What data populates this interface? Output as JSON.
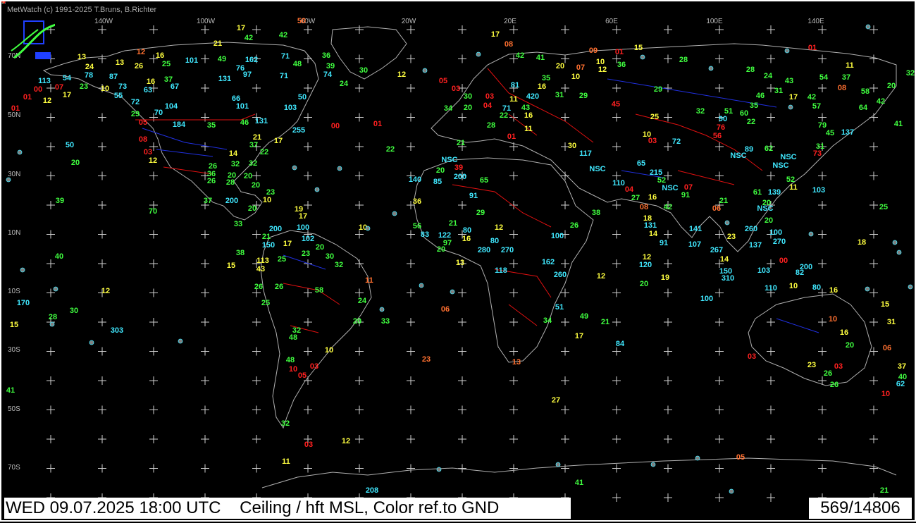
{
  "header": {
    "credit": "MetWatch  (c) 1991-2025 T.Bruns, B.Richter"
  },
  "footer": {
    "timestamp": "WED 09.07.2025 18:00 UTC",
    "parameter": "Ceiling / hft MSL, Color ref.to GND",
    "station_count": "569/14806"
  },
  "colors": {
    "background": "#000000",
    "coastline": "#b0b0b0",
    "country_border": "#e01010",
    "state_border": "#2030e0",
    "grid": "#d0d0d0",
    "red": "#ff2020",
    "orange": "#ff7030",
    "yellow": "#ffff40",
    "green": "#40ff40",
    "cyan": "#40e8ff"
  },
  "longitude_labels": [
    "140W",
    "100W",
    "60W",
    "20W",
    "20E",
    "60E",
    "100E",
    "140E"
  ],
  "latitude_labels": [
    "70N",
    "50N",
    "30N",
    "10N",
    "10S",
    "30S",
    "50S",
    "70S"
  ],
  "stations": [
    {
      "t": "17",
      "c": "yellow"
    },
    {
      "t": "42",
      "c": "green"
    },
    {
      "t": "42",
      "c": "green"
    },
    {
      "t": "50",
      "c": "orange"
    },
    {
      "t": "21",
      "c": "yellow"
    },
    {
      "t": "13",
      "c": "yellow"
    },
    {
      "t": "24",
      "c": "yellow"
    },
    {
      "t": "12",
      "c": "orange"
    },
    {
      "t": "16",
      "c": "yellow"
    },
    {
      "t": "13",
      "c": "yellow"
    },
    {
      "t": "26",
      "c": "yellow"
    },
    {
      "t": "25",
      "c": "green"
    },
    {
      "t": "101",
      "c": "cyan"
    },
    {
      "t": "49",
      "c": "green"
    },
    {
      "t": "162",
      "c": "cyan"
    },
    {
      "t": "71",
      "c": "cyan"
    },
    {
      "t": "48",
      "c": "green"
    },
    {
      "t": "36",
      "c": "green"
    },
    {
      "t": "39",
      "c": "green"
    },
    {
      "t": "30",
      "c": "green"
    },
    {
      "t": "74",
      "c": "cyan"
    },
    {
      "t": "24",
      "c": "green"
    },
    {
      "t": "113",
      "c": "cyan"
    },
    {
      "t": "54",
      "c": "cyan"
    },
    {
      "t": "78",
      "c": "cyan"
    },
    {
      "t": "87",
      "c": "cyan"
    },
    {
      "t": "16",
      "c": "yellow"
    },
    {
      "t": "37",
      "c": "green"
    },
    {
      "t": "131",
      "c": "cyan"
    },
    {
      "t": "76",
      "c": "cyan"
    },
    {
      "t": "97",
      "c": "cyan"
    },
    {
      "t": "71",
      "c": "cyan"
    },
    {
      "t": "00",
      "c": "red"
    },
    {
      "t": "07",
      "c": "red"
    },
    {
      "t": "23",
      "c": "green"
    },
    {
      "t": "10",
      "c": "yellow"
    },
    {
      "t": "73",
      "c": "cyan"
    },
    {
      "t": "63",
      "c": "cyan"
    },
    {
      "t": "67",
      "c": "cyan"
    },
    {
      "t": "01",
      "c": "red"
    },
    {
      "t": "12",
      "c": "yellow"
    },
    {
      "t": "17",
      "c": "yellow"
    },
    {
      "t": "55",
      "c": "cyan"
    },
    {
      "t": "72",
      "c": "cyan"
    },
    {
      "t": "66",
      "c": "cyan"
    },
    {
      "t": "101",
      "c": "cyan"
    },
    {
      "t": "50",
      "c": "cyan"
    },
    {
      "t": "103",
      "c": "cyan"
    },
    {
      "t": "01",
      "c": "red"
    },
    {
      "t": "29",
      "c": "green"
    },
    {
      "t": "70",
      "c": "cyan"
    },
    {
      "t": "104",
      "c": "cyan"
    },
    {
      "t": "46",
      "c": "green"
    },
    {
      "t": "131",
      "c": "cyan"
    },
    {
      "t": "05",
      "c": "red"
    },
    {
      "t": "184",
      "c": "cyan"
    },
    {
      "t": "35",
      "c": "green"
    },
    {
      "t": "255",
      "c": "cyan"
    },
    {
      "t": "00",
      "c": "red"
    },
    {
      "t": "01",
      "c": "red"
    },
    {
      "t": "08",
      "c": "red"
    },
    {
      "t": "21",
      "c": "yellow"
    },
    {
      "t": "37",
      "c": "green"
    },
    {
      "t": "17",
      "c": "yellow"
    },
    {
      "t": "50",
      "c": "cyan"
    },
    {
      "t": "03",
      "c": "red"
    },
    {
      "t": "14",
      "c": "yellow"
    },
    {
      "t": "22",
      "c": "green"
    },
    {
      "t": "22",
      "c": "green"
    },
    {
      "t": "20",
      "c": "green"
    },
    {
      "t": "12",
      "c": "yellow"
    },
    {
      "t": "26",
      "c": "green"
    },
    {
      "t": "32",
      "c": "green"
    },
    {
      "t": "32",
      "c": "green"
    },
    {
      "t": "36",
      "c": "green"
    },
    {
      "t": "20",
      "c": "green"
    },
    {
      "t": "20",
      "c": "green"
    },
    {
      "t": "26",
      "c": "green"
    },
    {
      "t": "28",
      "c": "green"
    },
    {
      "t": "20",
      "c": "green"
    },
    {
      "t": "23",
      "c": "green"
    },
    {
      "t": "39",
      "c": "green"
    },
    {
      "t": "37",
      "c": "green"
    },
    {
      "t": "200",
      "c": "cyan"
    },
    {
      "t": "10",
      "c": "yellow"
    },
    {
      "t": "20",
      "c": "green"
    },
    {
      "t": "19",
      "c": "yellow"
    },
    {
      "t": "70",
      "c": "green"
    },
    {
      "t": "17",
      "c": "yellow"
    },
    {
      "t": "33",
      "c": "green"
    },
    {
      "t": "200",
      "c": "cyan"
    },
    {
      "t": "100",
      "c": "cyan"
    },
    {
      "t": "10",
      "c": "yellow"
    },
    {
      "t": "21",
      "c": "green"
    },
    {
      "t": "102",
      "c": "cyan"
    },
    {
      "t": "150",
      "c": "cyan"
    },
    {
      "t": "17",
      "c": "yellow"
    },
    {
      "t": "20",
      "c": "green"
    },
    {
      "t": "40",
      "c": "green"
    },
    {
      "t": "38",
      "c": "green"
    },
    {
      "t": "23",
      "c": "green"
    },
    {
      "t": "113",
      "c": "yellow"
    },
    {
      "t": "25",
      "c": "green"
    },
    {
      "t": "30",
      "c": "green"
    },
    {
      "t": "15",
      "c": "yellow"
    },
    {
      "t": "43",
      "c": "yellow"
    },
    {
      "t": "32",
      "c": "green"
    },
    {
      "t": "11",
      "c": "orange"
    },
    {
      "t": "26",
      "c": "green"
    },
    {
      "t": "26",
      "c": "green"
    },
    {
      "t": "58",
      "c": "green"
    },
    {
      "t": "12",
      "c": "yellow"
    },
    {
      "t": "170",
      "c": "cyan"
    },
    {
      "t": "25",
      "c": "green"
    },
    {
      "t": "24",
      "c": "green"
    },
    {
      "t": "28",
      "c": "green"
    },
    {
      "t": "30",
      "c": "green"
    },
    {
      "t": "20",
      "c": "green"
    },
    {
      "t": "33",
      "c": "green"
    },
    {
      "t": "15",
      "c": "yellow"
    },
    {
      "t": "303",
      "c": "cyan"
    },
    {
      "t": "32",
      "c": "green"
    },
    {
      "t": "48",
      "c": "green"
    },
    {
      "t": "10",
      "c": "yellow"
    },
    {
      "t": "48",
      "c": "green"
    },
    {
      "t": "03",
      "c": "red"
    },
    {
      "t": "10",
      "c": "red"
    },
    {
      "t": "05",
      "c": "red"
    },
    {
      "t": "41",
      "c": "green"
    },
    {
      "t": "32",
      "c": "green"
    },
    {
      "t": "03",
      "c": "red"
    },
    {
      "t": "12",
      "c": "yellow"
    },
    {
      "t": "11",
      "c": "yellow"
    },
    {
      "t": "208",
      "c": "cyan"
    },
    {
      "t": "17",
      "c": "yellow"
    },
    {
      "t": "08",
      "c": "orange"
    },
    {
      "t": "42",
      "c": "green"
    },
    {
      "t": "41",
      "c": "green"
    },
    {
      "t": "09",
      "c": "orange"
    },
    {
      "t": "01",
      "c": "red"
    },
    {
      "t": "15",
      "c": "yellow"
    },
    {
      "t": "10",
      "c": "yellow"
    },
    {
      "t": "01",
      "c": "red"
    },
    {
      "t": "20",
      "c": "yellow"
    },
    {
      "t": "07",
      "c": "orange"
    },
    {
      "t": "10",
      "c": "yellow"
    },
    {
      "t": "36",
      "c": "green"
    },
    {
      "t": "28",
      "c": "green"
    },
    {
      "t": "28",
      "c": "green"
    },
    {
      "t": "24",
      "c": "green"
    },
    {
      "t": "43",
      "c": "green"
    },
    {
      "t": "54",
      "c": "green"
    },
    {
      "t": "37",
      "c": "green"
    },
    {
      "t": "11",
      "c": "yellow"
    },
    {
      "t": "32",
      "c": "green"
    },
    {
      "t": "12",
      "c": "yellow"
    },
    {
      "t": "05",
      "c": "red"
    },
    {
      "t": "03",
      "c": "red"
    },
    {
      "t": "81",
      "c": "cyan"
    },
    {
      "t": "16",
      "c": "yellow"
    },
    {
      "t": "35",
      "c": "green"
    },
    {
      "t": "12",
      "c": "yellow"
    },
    {
      "t": "30",
      "c": "green"
    },
    {
      "t": "03",
      "c": "red"
    },
    {
      "t": "11",
      "c": "yellow"
    },
    {
      "t": "420",
      "c": "cyan"
    },
    {
      "t": "31",
      "c": "green"
    },
    {
      "t": "29",
      "c": "green"
    },
    {
      "t": "29",
      "c": "green"
    },
    {
      "t": "31",
      "c": "green"
    },
    {
      "t": "17",
      "c": "yellow"
    },
    {
      "t": "42",
      "c": "green"
    },
    {
      "t": "58",
      "c": "green"
    },
    {
      "t": "08",
      "c": "orange"
    },
    {
      "t": "20",
      "c": "green"
    },
    {
      "t": "34",
      "c": "green"
    },
    {
      "t": "20",
      "c": "green"
    },
    {
      "t": "04",
      "c": "red"
    },
    {
      "t": "71",
      "c": "cyan"
    },
    {
      "t": "43",
      "c": "green"
    },
    {
      "t": "22",
      "c": "green"
    },
    {
      "t": "16",
      "c": "yellow"
    },
    {
      "t": "45",
      "c": "red"
    },
    {
      "t": "25",
      "c": "yellow"
    },
    {
      "t": "32",
      "c": "green"
    },
    {
      "t": "90",
      "c": "cyan"
    },
    {
      "t": "51",
      "c": "green"
    },
    {
      "t": "60",
      "c": "green"
    },
    {
      "t": "35",
      "c": "green"
    },
    {
      "t": "46",
      "c": "green"
    },
    {
      "t": "57",
      "c": "green"
    },
    {
      "t": "64",
      "c": "green"
    },
    {
      "t": "42",
      "c": "green"
    },
    {
      "t": "28",
      "c": "green"
    },
    {
      "t": "11",
      "c": "yellow"
    },
    {
      "t": "01",
      "c": "red"
    },
    {
      "t": "76",
      "c": "red"
    },
    {
      "t": "22",
      "c": "green"
    },
    {
      "t": "56",
      "c": "red"
    },
    {
      "t": "79",
      "c": "green"
    },
    {
      "t": "45",
      "c": "green"
    },
    {
      "t": "137",
      "c": "cyan"
    },
    {
      "t": "41",
      "c": "green"
    },
    {
      "t": "21",
      "c": "green"
    },
    {
      "t": "10",
      "c": "yellow"
    },
    {
      "t": "03",
      "c": "red"
    },
    {
      "t": "72",
      "c": "cyan"
    },
    {
      "t": "30",
      "c": "yellow"
    },
    {
      "t": "117",
      "c": "cyan"
    },
    {
      "t": "89",
      "c": "cyan"
    },
    {
      "t": "62",
      "c": "green"
    },
    {
      "t": "31",
      "c": "green"
    },
    {
      "t": "73",
      "c": "red"
    },
    {
      "t": "NSC",
      "c": "cyan"
    },
    {
      "t": "NSC",
      "c": "cyan"
    },
    {
      "t": "NSC",
      "c": "cyan"
    },
    {
      "t": "39",
      "c": "red"
    },
    {
      "t": "20",
      "c": "green"
    },
    {
      "t": "200",
      "c": "cyan"
    },
    {
      "t": "65",
      "c": "green"
    },
    {
      "t": "65",
      "c": "cyan"
    },
    {
      "t": "215",
      "c": "cyan"
    },
    {
      "t": "NSC",
      "c": "cyan"
    },
    {
      "t": "NSC",
      "c": "cyan"
    },
    {
      "t": "52",
      "c": "green"
    },
    {
      "t": "52",
      "c": "green"
    },
    {
      "t": "11",
      "c": "yellow"
    },
    {
      "t": "140",
      "c": "cyan"
    },
    {
      "t": "85",
      "c": "cyan"
    },
    {
      "t": "110",
      "c": "cyan"
    },
    {
      "t": "NSC",
      "c": "cyan"
    },
    {
      "t": "07",
      "c": "red"
    },
    {
      "t": "61",
      "c": "green"
    },
    {
      "t": "139",
      "c": "cyan"
    },
    {
      "t": "103",
      "c": "cyan"
    },
    {
      "t": "91",
      "c": "cyan"
    },
    {
      "t": "04",
      "c": "red"
    },
    {
      "t": "27",
      "c": "green"
    },
    {
      "t": "16",
      "c": "yellow"
    },
    {
      "t": "91",
      "c": "green"
    },
    {
      "t": "21",
      "c": "green"
    },
    {
      "t": "20",
      "c": "green"
    },
    {
      "t": "36",
      "c": "yellow"
    },
    {
      "t": "08",
      "c": "orange"
    },
    {
      "t": "42",
      "c": "green"
    },
    {
      "t": "06",
      "c": "orange"
    },
    {
      "t": "NSC",
      "c": "cyan"
    },
    {
      "t": "25",
      "c": "green"
    },
    {
      "t": "38",
      "c": "green"
    },
    {
      "t": "29",
      "c": "green"
    },
    {
      "t": "18",
      "c": "yellow"
    },
    {
      "t": "20",
      "c": "green"
    },
    {
      "t": "56",
      "c": "green"
    },
    {
      "t": "21",
      "c": "green"
    },
    {
      "t": "12",
      "c": "yellow"
    },
    {
      "t": "26",
      "c": "green"
    },
    {
      "t": "131",
      "c": "cyan"
    },
    {
      "t": "141",
      "c": "cyan"
    },
    {
      "t": "260",
      "c": "cyan"
    },
    {
      "t": "100",
      "c": "cyan"
    },
    {
      "t": "83",
      "c": "cyan"
    },
    {
      "t": "122",
      "c": "cyan"
    },
    {
      "t": "80",
      "c": "cyan"
    },
    {
      "t": "100",
      "c": "cyan"
    },
    {
      "t": "14",
      "c": "yellow"
    },
    {
      "t": "23",
      "c": "yellow"
    },
    {
      "t": "270",
      "c": "cyan"
    },
    {
      "t": "97",
      "c": "green"
    },
    {
      "t": "16",
      "c": "yellow"
    },
    {
      "t": "80",
      "c": "cyan"
    },
    {
      "t": "91",
      "c": "cyan"
    },
    {
      "t": "107",
      "c": "cyan"
    },
    {
      "t": "267",
      "c": "cyan"
    },
    {
      "t": "137",
      "c": "cyan"
    },
    {
      "t": "18",
      "c": "yellow"
    },
    {
      "t": "20",
      "c": "green"
    },
    {
      "t": "280",
      "c": "cyan"
    },
    {
      "t": "270",
      "c": "cyan"
    },
    {
      "t": "12",
      "c": "yellow"
    },
    {
      "t": "14",
      "c": "yellow"
    },
    {
      "t": "13",
      "c": "yellow"
    },
    {
      "t": "162",
      "c": "cyan"
    },
    {
      "t": "120",
      "c": "cyan"
    },
    {
      "t": "150",
      "c": "cyan"
    },
    {
      "t": "00",
      "c": "red"
    },
    {
      "t": "118",
      "c": "cyan"
    },
    {
      "t": "260",
      "c": "cyan"
    },
    {
      "t": "12",
      "c": "yellow"
    },
    {
      "t": "19",
      "c": "yellow"
    },
    {
      "t": "310",
      "c": "cyan"
    },
    {
      "t": "82",
      "c": "cyan"
    },
    {
      "t": "200",
      "c": "cyan"
    },
    {
      "t": "20",
      "c": "green"
    },
    {
      "t": "103",
      "c": "cyan"
    },
    {
      "t": "10",
      "c": "yellow"
    },
    {
      "t": "110",
      "c": "cyan"
    },
    {
      "t": "80",
      "c": "cyan"
    },
    {
      "t": "16",
      "c": "yellow"
    },
    {
      "t": "100",
      "c": "cyan"
    },
    {
      "t": "15",
      "c": "yellow"
    },
    {
      "t": "51",
      "c": "cyan"
    },
    {
      "t": "49",
      "c": "green"
    },
    {
      "t": "21",
      "c": "green"
    },
    {
      "t": "34",
      "c": "green"
    },
    {
      "t": "17",
      "c": "yellow"
    },
    {
      "t": "31",
      "c": "yellow"
    },
    {
      "t": "10",
      "c": "orange"
    },
    {
      "t": "16",
      "c": "yellow"
    },
    {
      "t": "20",
      "c": "green"
    },
    {
      "t": "06",
      "c": "orange"
    },
    {
      "t": "06",
      "c": "orange"
    },
    {
      "t": "84",
      "c": "cyan"
    },
    {
      "t": "13",
      "c": "orange"
    },
    {
      "t": "23",
      "c": "orange"
    },
    {
      "t": "03",
      "c": "red"
    },
    {
      "t": "23",
      "c": "yellow"
    },
    {
      "t": "03",
      "c": "red"
    },
    {
      "t": "26",
      "c": "green"
    },
    {
      "t": "26",
      "c": "green"
    },
    {
      "t": "37",
      "c": "yellow"
    },
    {
      "t": "40",
      "c": "green"
    },
    {
      "t": "62",
      "c": "cyan"
    },
    {
      "t": "10",
      "c": "red"
    },
    {
      "t": "27",
      "c": "yellow"
    },
    {
      "t": "05",
      "c": "orange"
    },
    {
      "t": "41",
      "c": "green"
    },
    {
      "t": "21",
      "c": "green"
    },
    {
      "t": "81",
      "c": "cyan"
    },
    {
      "t": "04",
      "c": "red"
    },
    {
      "t": "07",
      "c": "orange"
    }
  ]
}
